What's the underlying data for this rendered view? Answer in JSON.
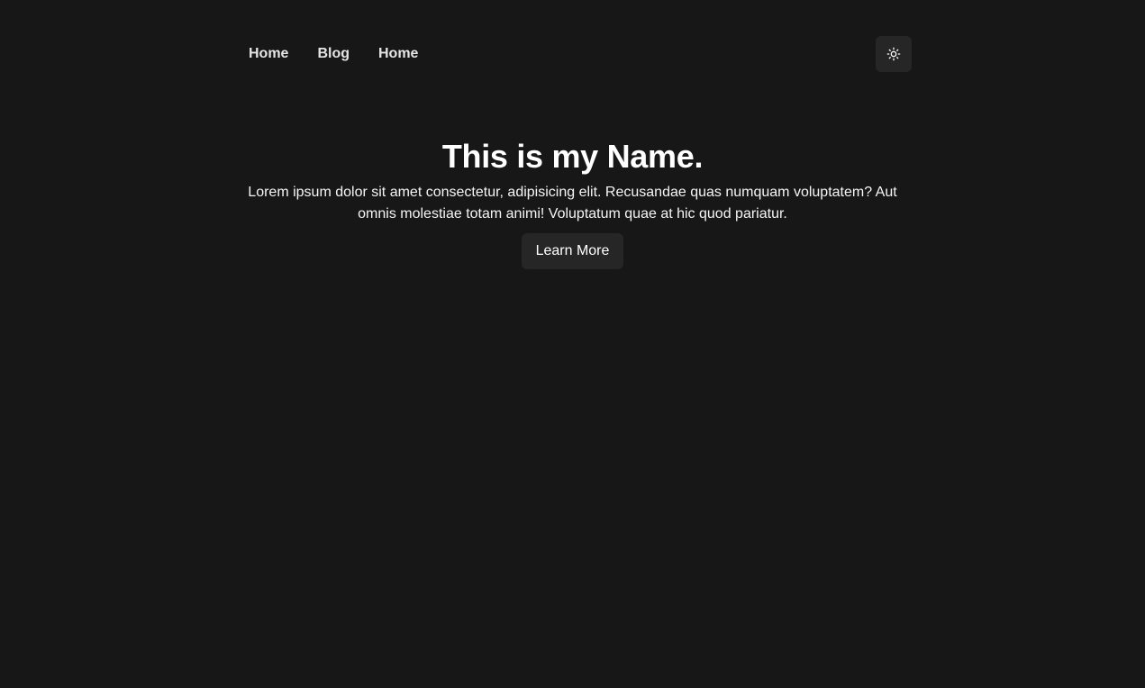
{
  "nav": {
    "links": [
      {
        "label": "Home"
      },
      {
        "label": "Blog"
      },
      {
        "label": "Home"
      }
    ],
    "theme_toggle_icon": "sun-icon"
  },
  "hero": {
    "title": "This is my Name.",
    "description": "Lorem ipsum dolor sit amet consectetur, adipisicing elit. Recusandae quas numquam voluptatem? Aut omnis molestiae totam animi! Voluptatum quae at hic quod pariatur.",
    "button_label": "Learn More"
  },
  "colors": {
    "background": "#171717",
    "surface": "#262626",
    "text": "#ffffff"
  }
}
